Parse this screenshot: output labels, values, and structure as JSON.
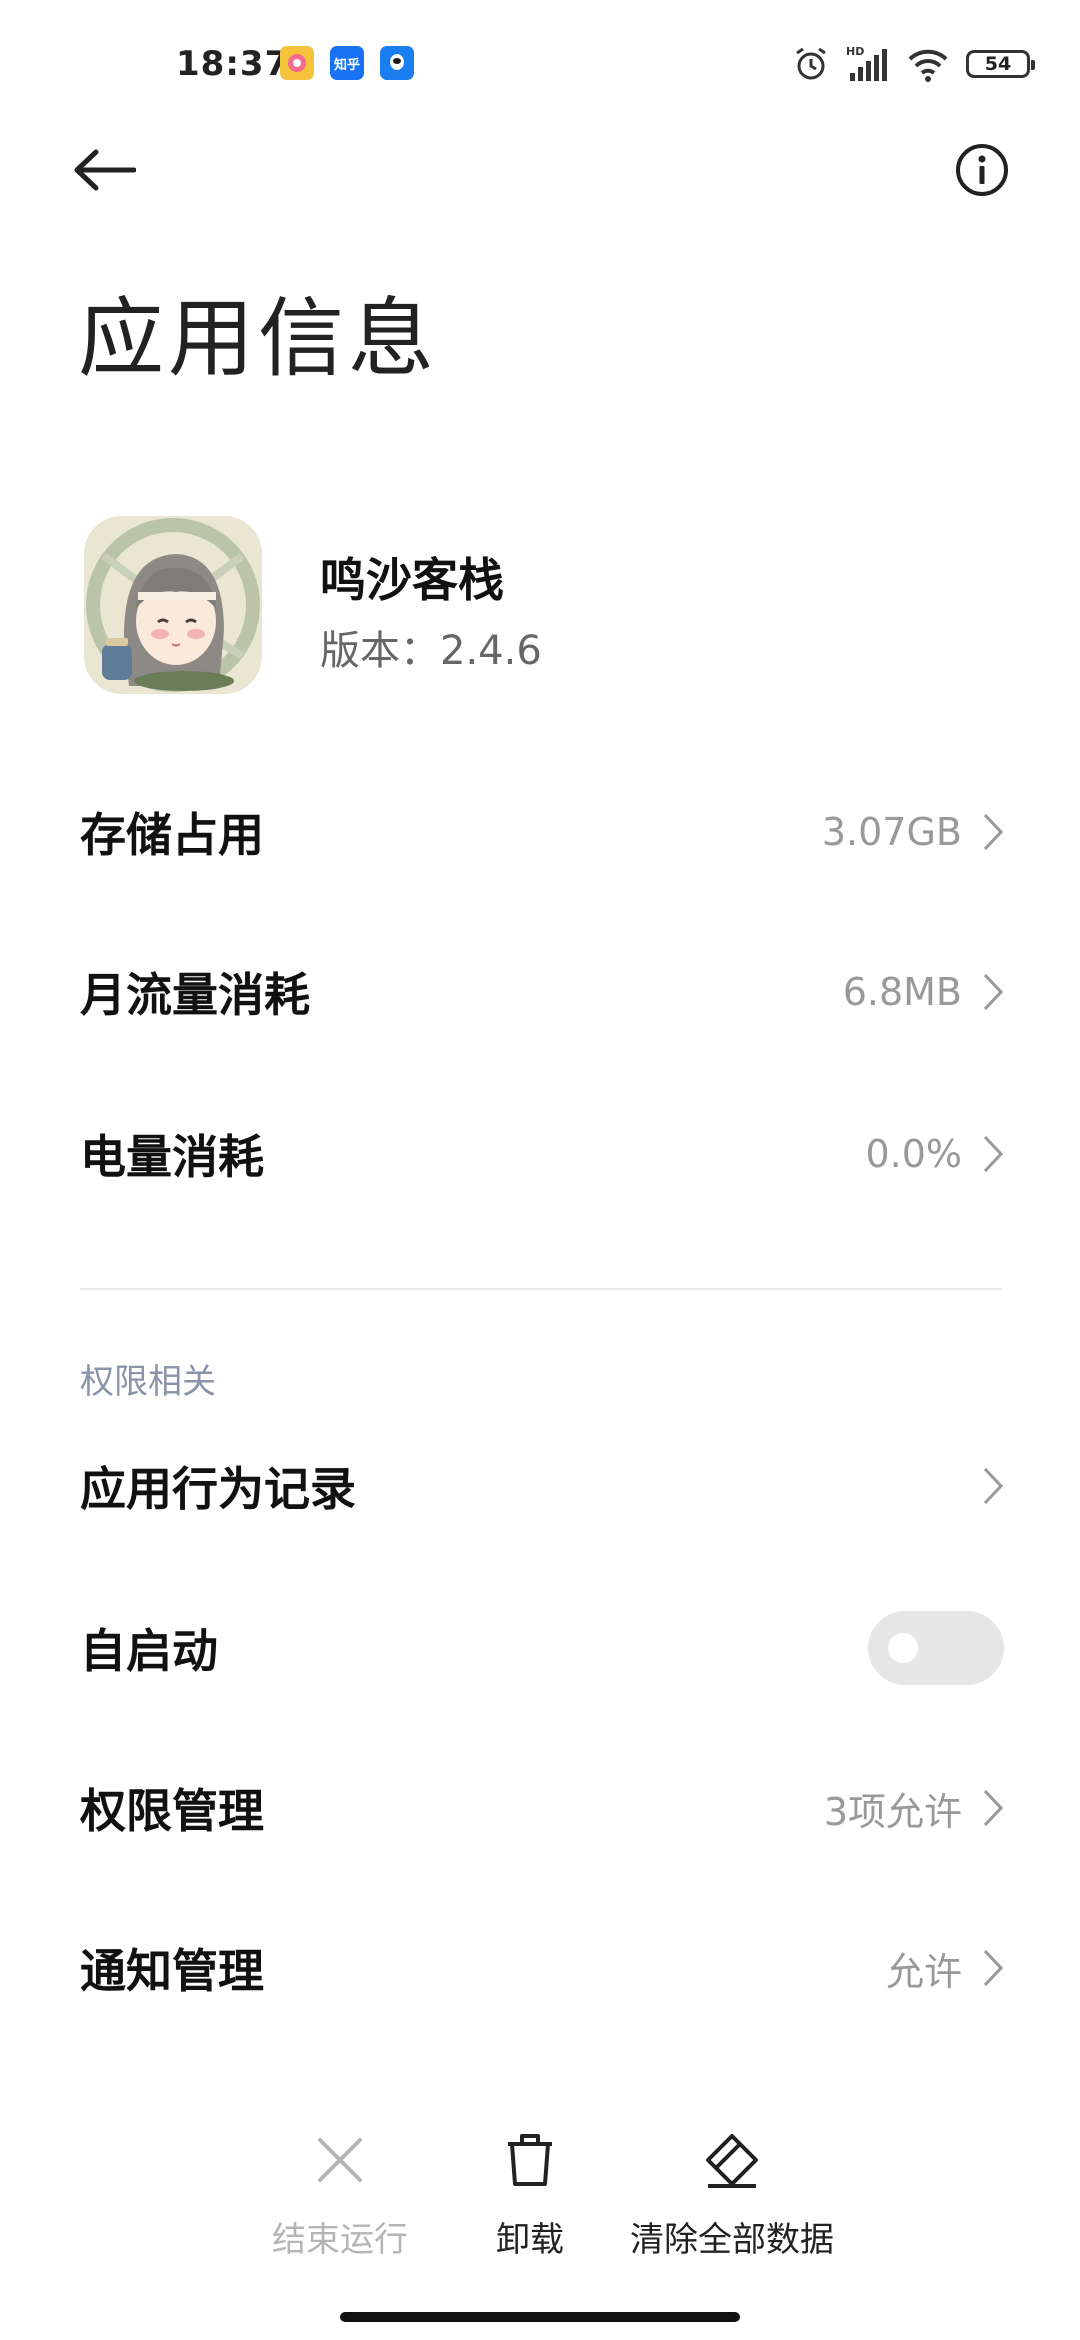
{
  "status_bar": {
    "time": "18:37",
    "notification_icons": [
      "meitu-icon",
      "zhihu-icon",
      "qq-icon"
    ],
    "zhihu_label": "知乎",
    "battery": "54"
  },
  "header": {
    "title": "应用信息"
  },
  "app": {
    "name": "鸣沙客栈",
    "version": "版本：2.4.6"
  },
  "rows": {
    "storage": {
      "label": "存储占用",
      "value": "3.07GB"
    },
    "traffic": {
      "label": "月流量消耗",
      "value": "6.8MB"
    },
    "battery": {
      "label": "电量消耗",
      "value": "0.0%"
    }
  },
  "permissions_section": {
    "title": "权限相关",
    "behavior": {
      "label": "应用行为记录"
    },
    "autostart": {
      "label": "自启动",
      "enabled": false
    },
    "permission_manage": {
      "label": "权限管理",
      "value": "3项允许"
    },
    "notification_manage": {
      "label": "通知管理",
      "value": "允许"
    }
  },
  "bottom_actions": {
    "force_stop": "结束运行",
    "uninstall": "卸载",
    "clear_data": "清除全部数据"
  },
  "colors": {
    "section_title": "#8a93a8",
    "value_text": "#999999",
    "toggle_off": "#e6e6e6"
  }
}
